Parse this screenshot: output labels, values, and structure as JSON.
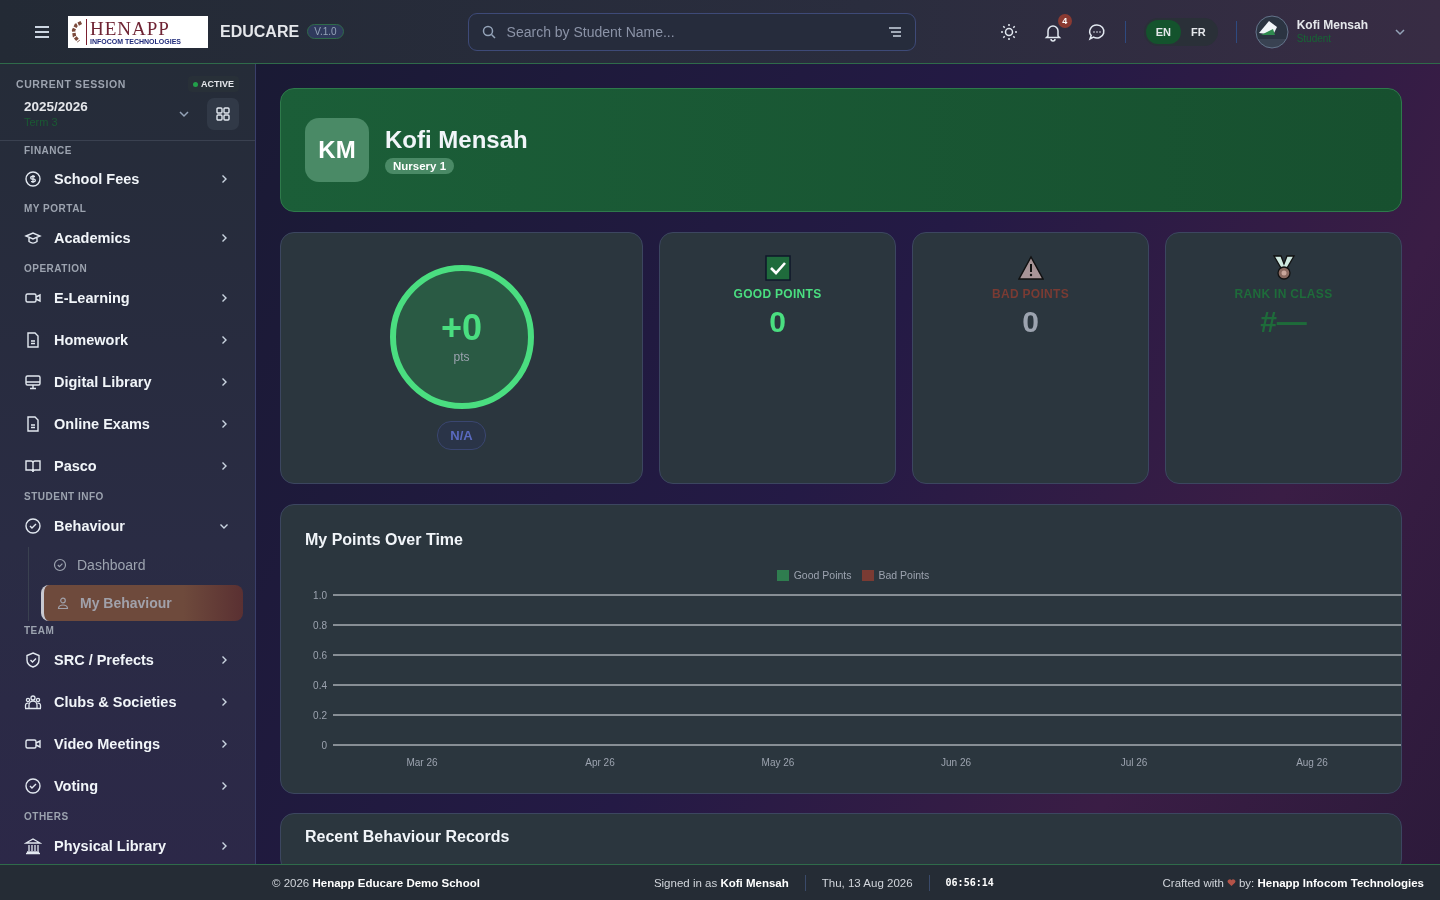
{
  "header": {
    "brand_logo": {
      "name": "HENAPP",
      "tagline": "INFOCOM TECHNOLOGIES"
    },
    "app_name": "EDUCARE",
    "version": "V.1.0",
    "search": {
      "placeholder": "Search by Student Name..."
    },
    "notifications_count": "4",
    "languages": [
      {
        "label": "EN",
        "selected": true
      },
      {
        "label": "FR",
        "selected": false
      }
    ],
    "user": {
      "name": "Kofi Mensah",
      "role": "Student"
    }
  },
  "session": {
    "label": "CURRENT SESSION",
    "status": "ACTIVE",
    "year": "2025/2026",
    "term": "Term 3"
  },
  "sidebar": [
    {
      "heading": "FINANCE",
      "items": [
        {
          "label": "School Fees",
          "expanded": false
        }
      ]
    },
    {
      "heading": "MY PORTAL",
      "items": [
        {
          "label": "Academics",
          "expanded": false
        }
      ]
    },
    {
      "heading": "OPERATION",
      "items": [
        {
          "label": "E-Learning",
          "expanded": false
        },
        {
          "label": "Homework",
          "expanded": false
        },
        {
          "label": "Digital Library",
          "expanded": false
        },
        {
          "label": "Online Exams",
          "expanded": false
        },
        {
          "label": "Pasco",
          "expanded": false
        }
      ]
    },
    {
      "heading": "STUDENT INFO",
      "items": [
        {
          "label": "Behaviour",
          "expanded": true,
          "children": [
            {
              "label": "Dashboard",
              "selected": false
            },
            {
              "label": "My Behaviour",
              "selected": true
            }
          ]
        }
      ]
    },
    {
      "heading": "TEAM",
      "items": [
        {
          "label": "SRC / Prefects",
          "expanded": false
        },
        {
          "label": "Clubs & Societies",
          "expanded": false
        },
        {
          "label": "Video Meetings",
          "expanded": false
        },
        {
          "label": "Voting",
          "expanded": false
        }
      ]
    },
    {
      "heading": "OTHERS",
      "items": [
        {
          "label": "Physical Library",
          "expanded": false
        }
      ]
    }
  ],
  "profile": {
    "initials": "KM",
    "name": "Kofi Mensah",
    "class": "Nursery 1"
  },
  "score": {
    "value": "+0",
    "unit": "pts",
    "rating": "N/A"
  },
  "stats": [
    {
      "kind": "good",
      "label": "GOOD POINTS",
      "value": "0",
      "color": "#4ade80"
    },
    {
      "kind": "bad",
      "label": "BAD POINTS",
      "value": "0",
      "color": "#7a3b33"
    },
    {
      "kind": "rank",
      "label": "RANK IN CLASS",
      "value": "#—",
      "color": "#1e6b3a"
    }
  ],
  "points_chart": {
    "title": "My Points Over Time",
    "chart_data": {
      "type": "line",
      "grid": true,
      "categories": [
        "Mar 26",
        "Apr 26",
        "May 26",
        "Jun 26",
        "Jul 26",
        "Aug 26"
      ],
      "series": [
        {
          "name": "Good Points",
          "color": "#2f7d4f",
          "values": [
            null,
            null,
            null,
            null,
            null,
            null
          ]
        },
        {
          "name": "Bad Points",
          "color": "#7a3b33",
          "values": [
            null,
            null,
            null,
            null,
            null,
            null
          ]
        }
      ],
      "ylim": [
        0,
        1
      ],
      "yticks": [
        0,
        {
          "value": 0.2,
          "label": "0.2"
        },
        {
          "value": 0.4,
          "label": "0.4"
        },
        {
          "value": 0.6,
          "label": "0.6"
        },
        {
          "value": 0.8,
          "label": "0.8"
        },
        {
          "value": 1,
          "label": "1.0"
        }
      ]
    }
  },
  "records": {
    "title": "Recent Behaviour Records"
  },
  "footer": {
    "copyright": "© 2026 **Henapp Educare Demo School**",
    "signed_in": "Signed in as **Kofi Mensah**",
    "date": "Thu, 13 Aug 2026",
    "time": "06:56:14",
    "credit_prefix": "Crafted with",
    "credit": "by: **Henapp Infocom Technologies**"
  }
}
